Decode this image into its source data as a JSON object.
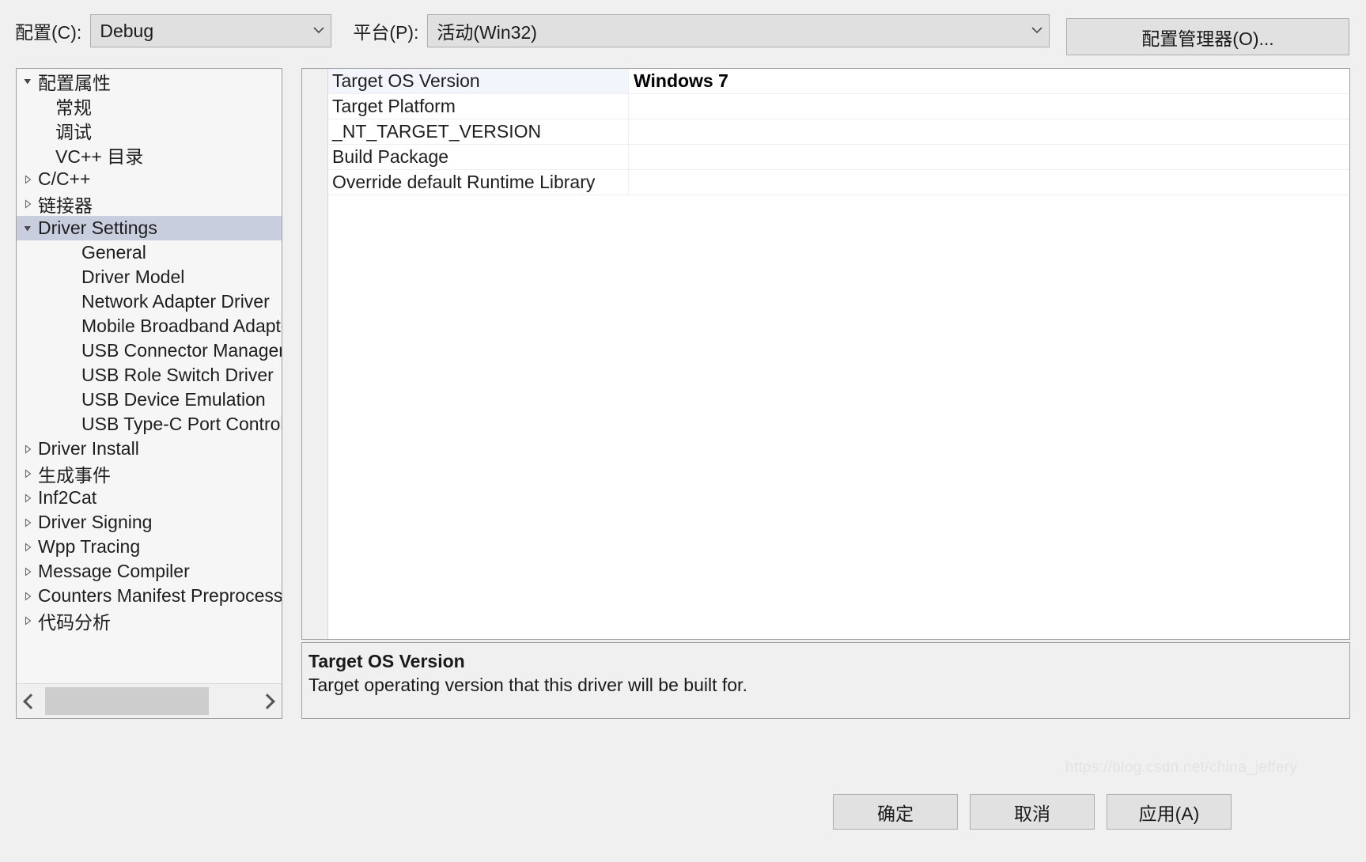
{
  "toolbar": {
    "config_label": "配置(C):",
    "config_value": "Debug",
    "platform_label": "平台(P):",
    "platform_value": "活动(Win32)",
    "config_manager_button": "配置管理器(O)..."
  },
  "tree": {
    "items": [
      {
        "label": "配置属性",
        "level": 0,
        "twisty": "expanded",
        "selected": false
      },
      {
        "label": "常规",
        "level": 1,
        "twisty": "none",
        "selected": false
      },
      {
        "label": "调试",
        "level": 1,
        "twisty": "none",
        "selected": false
      },
      {
        "label": "VC++ 目录",
        "level": 1,
        "twisty": "none",
        "selected": false
      },
      {
        "label": "C/C++",
        "level": 0,
        "twisty": "collapsed",
        "selected": false
      },
      {
        "label": "链接器",
        "level": 0,
        "twisty": "collapsed",
        "selected": false
      },
      {
        "label": "Driver Settings",
        "level": 0,
        "twisty": "expanded",
        "selected": true
      },
      {
        "label": "General",
        "level": 2,
        "twisty": "none",
        "selected": false
      },
      {
        "label": "Driver Model",
        "level": 2,
        "twisty": "none",
        "selected": false
      },
      {
        "label": "Network Adapter Driver",
        "level": 2,
        "twisty": "none",
        "selected": false
      },
      {
        "label": "Mobile Broadband Adapter",
        "level": 2,
        "twisty": "none",
        "selected": false
      },
      {
        "label": "USB Connector Manager",
        "level": 2,
        "twisty": "none",
        "selected": false
      },
      {
        "label": "USB Role Switch Driver",
        "level": 2,
        "twisty": "none",
        "selected": false
      },
      {
        "label": "USB Device Emulation",
        "level": 2,
        "twisty": "none",
        "selected": false
      },
      {
        "label": "USB Type-C Port Controller",
        "level": 2,
        "twisty": "none",
        "selected": false
      },
      {
        "label": "Driver Install",
        "level": 0,
        "twisty": "collapsed",
        "selected": false
      },
      {
        "label": "生成事件",
        "level": 0,
        "twisty": "collapsed",
        "selected": false
      },
      {
        "label": "Inf2Cat",
        "level": 0,
        "twisty": "collapsed",
        "selected": false
      },
      {
        "label": "Driver Signing",
        "level": 0,
        "twisty": "collapsed",
        "selected": false
      },
      {
        "label": "Wpp Tracing",
        "level": 0,
        "twisty": "collapsed",
        "selected": false
      },
      {
        "label": "Message Compiler",
        "level": 0,
        "twisty": "collapsed",
        "selected": false
      },
      {
        "label": "Counters Manifest Preprocessor",
        "level": 0,
        "twisty": "collapsed",
        "selected": false
      },
      {
        "label": "代码分析",
        "level": 0,
        "twisty": "collapsed",
        "selected": false
      }
    ]
  },
  "grid": {
    "rows": [
      {
        "name": "Target OS Version",
        "value": "Windows 7",
        "selected": true
      },
      {
        "name": "Target Platform",
        "value": "",
        "selected": false
      },
      {
        "name": "_NT_TARGET_VERSION",
        "value": "",
        "selected": false
      },
      {
        "name": "Build Package",
        "value": "",
        "selected": false
      },
      {
        "name": "Override default Runtime Library",
        "value": "",
        "selected": false
      }
    ]
  },
  "description": {
    "title": "Target OS Version",
    "text": "Target operating version that this driver will be built for."
  },
  "footer": {
    "ok": "确定",
    "cancel": "取消",
    "apply": "应用(A)"
  },
  "watermark": {
    "text": "https://blog.csdn.net/china_jeffery"
  },
  "colors": {
    "dialog_bg": "#f0f0f0",
    "tree_bg": "#f6f6f6",
    "tree_selection": "#c9cede",
    "grid_row_selection": "#f2f6fc",
    "border": "#a0a0a0",
    "button_face": "#e1e1e1",
    "combo_face": "#e0e0e0"
  }
}
